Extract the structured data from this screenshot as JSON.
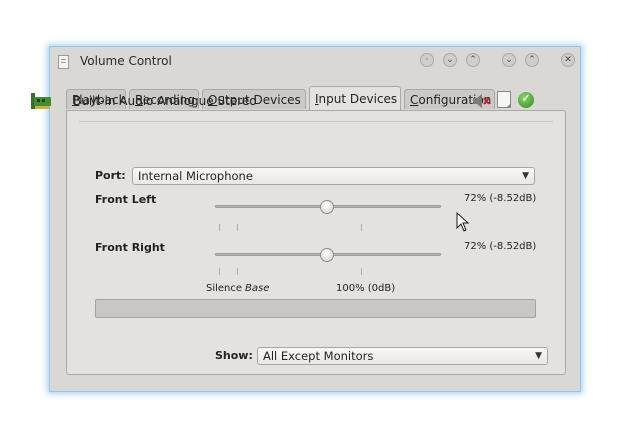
{
  "window": {
    "title": "Volume Control"
  },
  "tabs": [
    {
      "label": "Playback",
      "active": false
    },
    {
      "label": "Recording",
      "active": false
    },
    {
      "label": "Output Devices",
      "active": false
    },
    {
      "label": "Input Devices",
      "active": true
    },
    {
      "label": "Configuration",
      "active": false
    }
  ],
  "device": {
    "name": "Built-in Audio Analogue Stereo",
    "icons": [
      "sound-card-icon",
      "mute-icon",
      "lock-icon",
      "default-check-icon"
    ]
  },
  "port": {
    "label": "Port:",
    "value": "Internal Microphone"
  },
  "channels": [
    {
      "label": "Front Left",
      "value_text": "72% (-8.52dB)",
      "level": 0.72
    },
    {
      "label": "Front Right",
      "value_text": "72% (-8.52dB)",
      "level": 0.72
    }
  ],
  "scale": {
    "silence": "Silence",
    "base": "Base",
    "hundred": "100% (0dB)"
  },
  "peak_meter": {
    "level": 0
  },
  "show": {
    "label": "Show:",
    "value": "All Except Monitors"
  },
  "colors": {
    "window_border": "#8fc7ee",
    "window_bg": "#d9d8d5",
    "panel_bg": "#e3e2df"
  }
}
